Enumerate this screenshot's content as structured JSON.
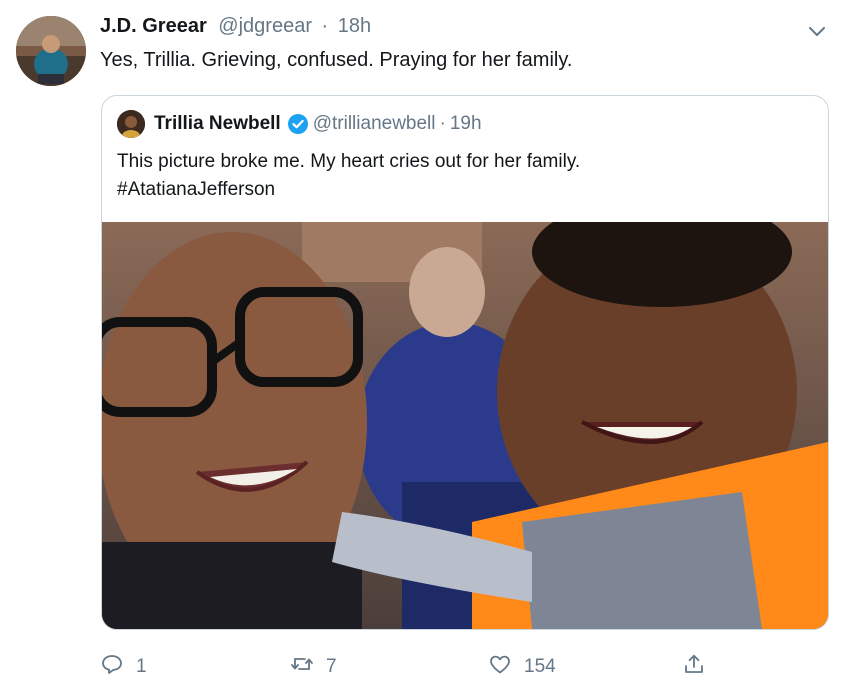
{
  "tweet": {
    "author_name": "J.D. Greear",
    "author_handle": "@jdgreear",
    "separator": "·",
    "time": "18h",
    "text": "Yes, Trillia. Grieving, confused. Praying for her family."
  },
  "quoted": {
    "author_name": "Trillia Newbell",
    "author_handle": "@trillianewbell",
    "separator": "·",
    "time": "19h",
    "text_line1": "This picture broke me. My heart cries out for her family.",
    "text_line2": "#AtatianaJefferson"
  },
  "actions": {
    "reply_count": "1",
    "retweet_count": "7",
    "like_count": "154"
  },
  "icons": [
    "chevron-down-icon",
    "verified-badge-icon",
    "reply-icon",
    "retweet-icon",
    "like-icon",
    "share-icon"
  ],
  "colors": {
    "text": "#14171a",
    "muted": "#657786",
    "border": "#ccd6dd",
    "verified": "#1da1f2"
  }
}
